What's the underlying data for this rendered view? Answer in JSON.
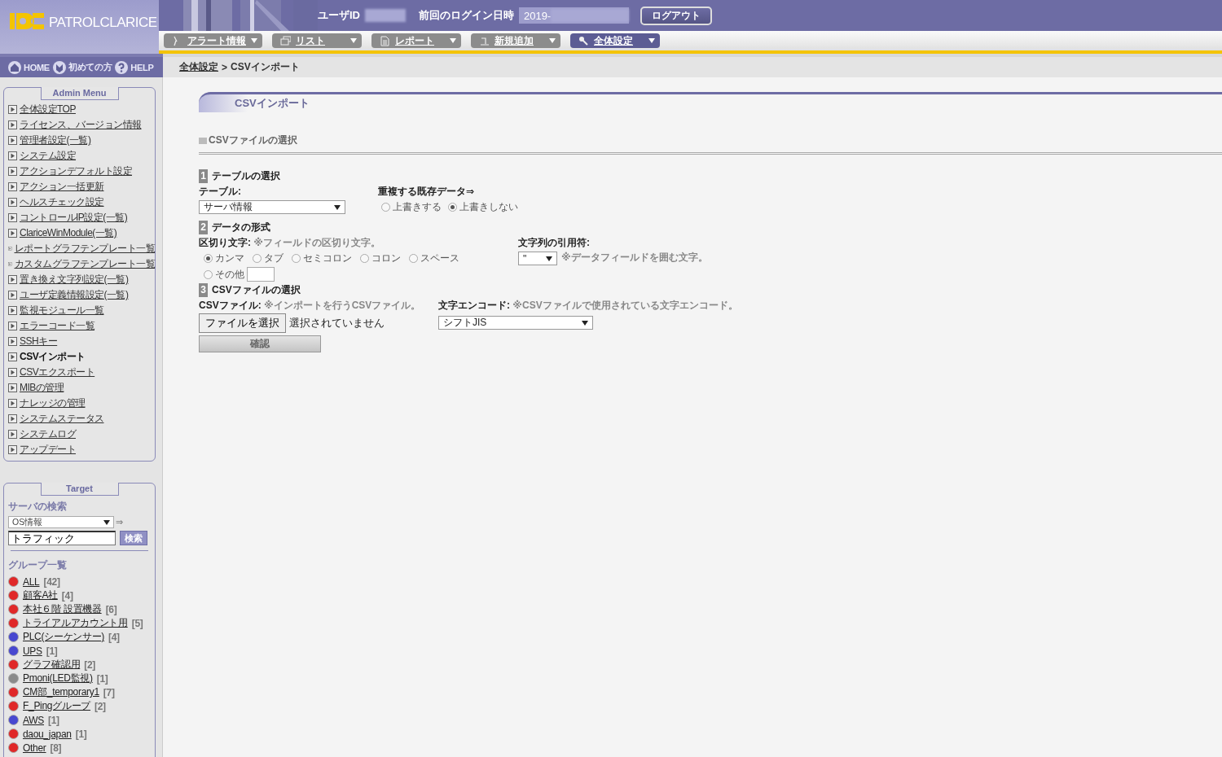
{
  "header": {
    "logo": "PATROLCLARICE",
    "user_label": "ユーザID",
    "last_login_label": "前回のログイン日時",
    "last_login_value": "2019-",
    "logout": "ログアウト"
  },
  "nav_tabs": [
    {
      "label": "アラート情報",
      "selected": false
    },
    {
      "label": "リスト",
      "selected": false
    },
    {
      "label": "レポート",
      "selected": false
    },
    {
      "label": "新規追加",
      "selected": false
    },
    {
      "label": "全体設定",
      "selected": true
    }
  ],
  "quick_links": [
    {
      "label": "HOME"
    },
    {
      "label": "初めての方"
    },
    {
      "label": "HELP"
    }
  ],
  "breadcrumb": {
    "parent": "全体設定",
    "separator": ">",
    "current": "CSVインポート"
  },
  "admin_menu": {
    "title": "Admin Menu",
    "items": [
      {
        "label": "全体設定TOP",
        "selected": false
      },
      {
        "label": "ライセンス、バージョン情報",
        "selected": false
      },
      {
        "label": "管理者設定(一覧)",
        "selected": false
      },
      {
        "label": "システム設定",
        "selected": false
      },
      {
        "label": "アクションデフォルト設定",
        "selected": false
      },
      {
        "label": "アクション一括更新",
        "selected": false
      },
      {
        "label": "ヘルスチェック設定",
        "selected": false
      },
      {
        "label": "コントロールIP設定(一覧)",
        "selected": false
      },
      {
        "label": "ClariceWinModule(一覧)",
        "selected": false
      },
      {
        "label": "レポートグラフテンプレート一覧",
        "selected": false
      },
      {
        "label": "カスタムグラフテンプレート一覧",
        "selected": false
      },
      {
        "label": "置き換え文字列設定(一覧)",
        "selected": false
      },
      {
        "label": "ユーザ定義情報設定(一覧)",
        "selected": false
      },
      {
        "label": "監視モジュール一覧",
        "selected": false
      },
      {
        "label": "エラーコード一覧",
        "selected": false
      },
      {
        "label": "SSHキー",
        "selected": false
      },
      {
        "label": "CSVインポート",
        "selected": true
      },
      {
        "label": "CSVエクスポート",
        "selected": false
      },
      {
        "label": "MIBの管理",
        "selected": false
      },
      {
        "label": "ナレッジの管理",
        "selected": false
      },
      {
        "label": "システムステータス",
        "selected": false
      },
      {
        "label": "システムログ",
        "selected": false
      },
      {
        "label": "アップデート",
        "selected": false
      }
    ]
  },
  "target": {
    "title": "Target",
    "search_label": "サーバの検索",
    "search_type": "OS情報",
    "arrow": "⇒",
    "keyword": "トラフィック",
    "search_button": "検索",
    "group_heading": "グループ一覧",
    "groups": [
      {
        "name": "ALL",
        "count": "[42]",
        "color": "#e02828"
      },
      {
        "name": "顧客A社",
        "count": "[4]",
        "color": "#e02828"
      },
      {
        "name": "本社６階 設置機器",
        "count": "[6]",
        "color": "#e02828"
      },
      {
        "name": "トライアルアカウント用",
        "count": "[5]",
        "color": "#e02828"
      },
      {
        "name": "PLC(シーケンサー)",
        "count": "[4]",
        "color": "#4848d0"
      },
      {
        "name": "UPS",
        "count": "[1]",
        "color": "#4848d0"
      },
      {
        "name": "グラフ確認用",
        "count": "[2]",
        "color": "#e02828"
      },
      {
        "name": "Pmoni(LED監視)",
        "count": "[1]",
        "color": "#8a8a8a"
      },
      {
        "name": "CM部_temporary1",
        "count": "[7]",
        "color": "#e02828"
      },
      {
        "name": "F_Pingグループ",
        "count": "[2]",
        "color": "#e02828"
      },
      {
        "name": "AWS",
        "count": "[1]",
        "color": "#4848d0"
      },
      {
        "name": "daou_japan",
        "count": "[1]",
        "color": "#e02828"
      },
      {
        "name": "Other",
        "count": "[8]",
        "color": "#e02828"
      }
    ]
  },
  "page": {
    "title": "CSVインポート",
    "section_title": "CSVファイルの選択",
    "step1": {
      "number": "1",
      "title": "テーブルの選択",
      "table_label": "テーブル:",
      "table_value": "サーバ情報",
      "duplicate_label": "重複する既存データ⇒",
      "duplicate_options": [
        {
          "label": "上書きする",
          "selected": false
        },
        {
          "label": "上書きしない",
          "selected": true
        }
      ]
    },
    "step2": {
      "number": "2",
      "title": "データの形式",
      "delimiter_label": "区切り文字:",
      "delimiter_note": "※フィールドの区切り文字。",
      "delimiters": [
        {
          "label": "カンマ",
          "selected": true
        },
        {
          "label": "タブ",
          "selected": false
        },
        {
          "label": "セミコロン",
          "selected": false
        },
        {
          "label": "コロン",
          "selected": false
        },
        {
          "label": "スペース",
          "selected": false
        },
        {
          "label": "その他",
          "selected": false
        }
      ],
      "quote_label": "文字列の引用符:",
      "quote_value": "\"",
      "quote_note": "※データフィールドを囲む文字。"
    },
    "step3": {
      "number": "3",
      "title": "CSVファイルの選択",
      "file_label": "CSVファイル:",
      "file_note": "※インポートを行うCSVファイル。",
      "file_button": "ファイルを選択",
      "file_status": "選択されていません",
      "encoding_label": "文字エンコード:",
      "encoding_note": "※CSVファイルで使用されている文字エンコード。",
      "encoding_value": "シフトJIS"
    },
    "confirm_button": "確認"
  }
}
